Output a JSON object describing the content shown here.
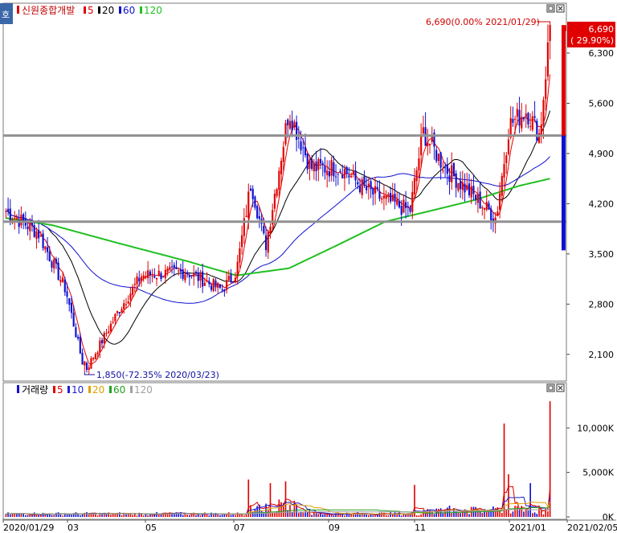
{
  "header": {
    "badge": "호",
    "stock_name": "신원종합개발",
    "ma_labels": [
      "5",
      "20",
      "60",
      "120"
    ],
    "ma_colors": [
      "#e00000",
      "#000000",
      "#1010d0",
      "#20c020"
    ]
  },
  "volume_header": {
    "title": "거래량",
    "ma_labels": [
      "5",
      "10",
      "20",
      "60",
      "120"
    ],
    "ma_colors": [
      "#e00000",
      "#2020d0",
      "#e0a000",
      "#20a020",
      "#a0a0a0"
    ]
  },
  "annotations": {
    "high": "6,690(0.00% 2021/01/29)",
    "low": "1,850(-72.35% 2020/03/23)"
  },
  "current": {
    "price": "6,690",
    "change": "( 29.90%)"
  },
  "price_axis": [
    "6,300",
    "5,600",
    "4,900",
    "4,200",
    "3,500",
    "2,800",
    "2,100"
  ],
  "volume_axis": [
    "10,000K",
    "5,000K",
    "0K"
  ],
  "x_axis": [
    "2020/01/29",
    "03",
    "05",
    "07",
    "09",
    "11",
    "2021/01",
    "2021/02/05"
  ],
  "window_buttons": [
    "□",
    "×"
  ],
  "colors": {
    "up": "#e00000",
    "down": "#1010d0",
    "resistance": "#909090"
  },
  "chart_data": [
    {
      "type": "candlestick",
      "title": "신원종합개발",
      "period": [
        "2020/01/29",
        "2021/02/05"
      ],
      "x_tick_labels": [
        "2020/01/29",
        "03",
        "05",
        "07",
        "09",
        "11",
        "2021/01",
        "2021/02/05"
      ],
      "y_ticks": [
        2100,
        2800,
        3500,
        4200,
        4900,
        5600,
        6300
      ],
      "ylim": [
        1750,
        6950
      ],
      "horizontal_lines": [
        5150,
        3950
      ],
      "moving_averages": [
        5,
        20,
        60,
        120
      ],
      "high_point": {
        "date": "2021/01/29",
        "value": 6690
      },
      "low_point": {
        "date": "2020/03/23",
        "value": 1850,
        "change_pct": -72.35
      },
      "last_close": 6690,
      "last_change_pct": 29.9,
      "price_path": [
        [
          "2020/01/29",
          4100
        ],
        [
          "2020/02/20",
          3800
        ],
        [
          "2020/03/10",
          3000
        ],
        [
          "2020/03/23",
          1850
        ],
        [
          "2020/04/15",
          2700
        ],
        [
          "2020/05/01",
          3200
        ],
        [
          "2020/06/01",
          3250
        ],
        [
          "2020/06/25",
          3000
        ],
        [
          "2020/07/05",
          3250
        ],
        [
          "2020/07/15",
          4500
        ],
        [
          "2020/07/25",
          3600
        ],
        [
          "2020/08/10",
          5500
        ],
        [
          "2020/08/25",
          4700
        ],
        [
          "2020/09/15",
          4700
        ],
        [
          "2020/10/01",
          4400
        ],
        [
          "2020/10/15",
          4250
        ],
        [
          "2020/11/01",
          4100
        ],
        [
          "2020/11/10",
          5200
        ],
        [
          "2020/11/25",
          4700
        ],
        [
          "2020/12/15",
          4300
        ],
        [
          "2020/12/30",
          4000
        ],
        [
          "2021/01/08",
          5300
        ],
        [
          "2021/01/20",
          5500
        ],
        [
          "2021/01/29",
          5150
        ],
        [
          "2021/02/05",
          6690
        ]
      ],
      "ma120_path": [
        [
          "2020/01/29",
          4000
        ],
        [
          "2020/03/01",
          3900
        ],
        [
          "2020/04/15",
          3650
        ],
        [
          "2020/06/01",
          3400
        ],
        [
          "2020/07/05",
          3200
        ],
        [
          "2020/08/10",
          3300
        ],
        [
          "2020/09/15",
          3650
        ],
        [
          "2020/10/15",
          3950
        ],
        [
          "2020/11/15",
          4100
        ],
        [
          "2020/12/15",
          4250
        ],
        [
          "2021/01/15",
          4450
        ],
        [
          "2021/02/05",
          4550
        ]
      ]
    },
    {
      "type": "bar",
      "title": "거래량",
      "unit": "K",
      "y_ticks": [
        0,
        5000,
        10000
      ],
      "ylim": [
        0,
        14000
      ],
      "spikes": [
        [
          "2020/07/13",
          4200
        ],
        [
          "2020/07/28",
          3800
        ],
        [
          "2020/08/07",
          4000
        ],
        [
          "2020/11/04",
          3600
        ],
        [
          "2021/01/04",
          10500
        ],
        [
          "2021/01/08",
          4800
        ],
        [
          "2021/01/22",
          3800
        ],
        [
          "2021/02/05",
          13000
        ]
      ]
    }
  ]
}
